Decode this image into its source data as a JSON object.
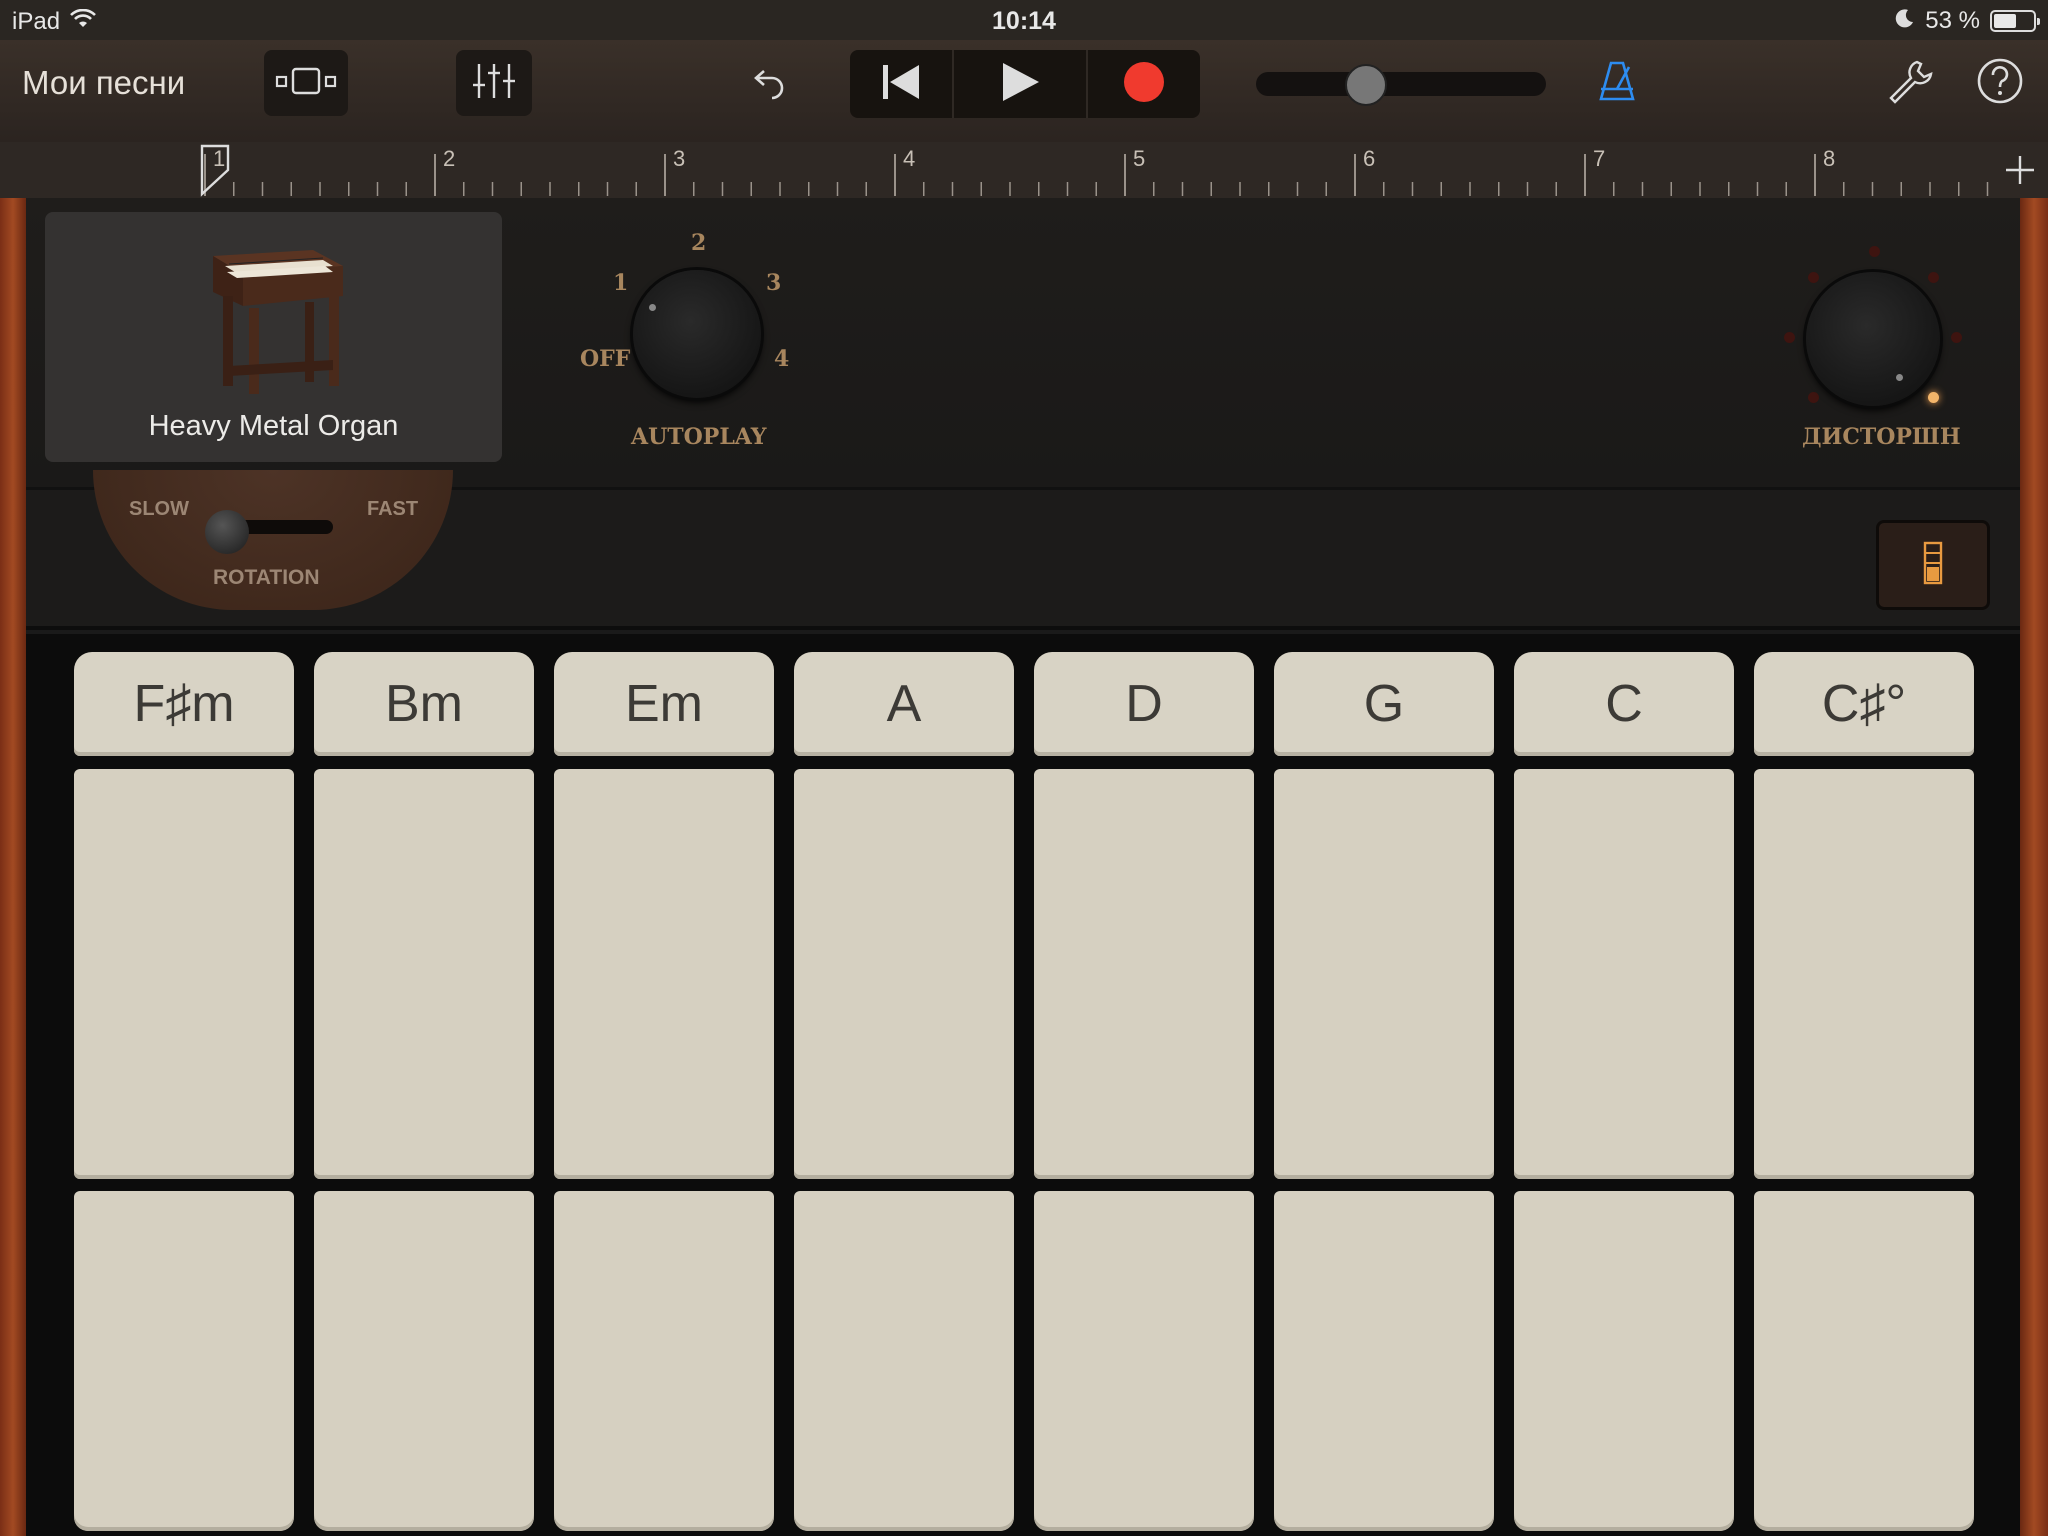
{
  "status_bar": {
    "device": "iPad",
    "time": "10:14",
    "battery": "53 %",
    "battery_level": 0.53
  },
  "toolbar": {
    "my_songs": "Мои песни",
    "icons": [
      "view-toggle-icon",
      "mixer-icon",
      "undo-icon",
      "rewind-icon",
      "play-icon",
      "record-icon",
      "metronome-icon",
      "wrench-icon",
      "help-icon"
    ],
    "volume_level": 0.38,
    "record_color": "#f03a2e",
    "metronome_color": "#2d8cf0"
  },
  "ruler": {
    "bars": [
      "1",
      "2",
      "3",
      "4",
      "5",
      "6",
      "7",
      "8"
    ]
  },
  "instrument": {
    "name": "Heavy Metal Organ"
  },
  "autoplay": {
    "label": "AUTOPLAY",
    "positions": [
      "OFF",
      "1",
      "2",
      "3",
      "4"
    ],
    "selected": "OFF"
  },
  "distortion": {
    "label": "ДИСТОРШН"
  },
  "rotation": {
    "label": "ROTATION",
    "slow": "SLOW",
    "fast": "FAST",
    "selected": "SLOW"
  },
  "chords": [
    "F♯m",
    "Bm",
    "Em",
    "A",
    "D",
    "G",
    "C",
    "C♯°"
  ]
}
